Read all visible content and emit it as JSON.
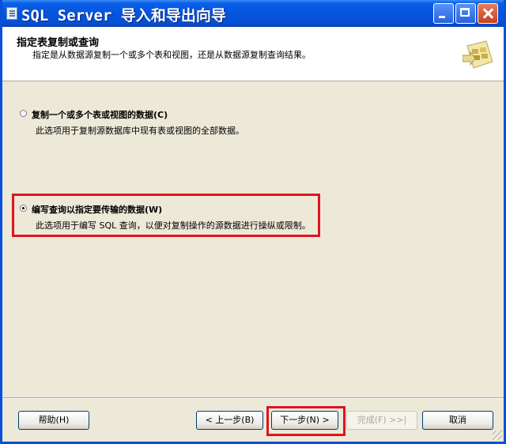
{
  "window": {
    "title": "SQL Server 导入和导出向导",
    "accent": "#0654dd"
  },
  "header": {
    "title": "指定表复制或查询",
    "description": "指定是从数据源复制一个或多个表和视图，还是从数据源复制查询结果。",
    "icon": "wizard-tables-icon"
  },
  "options": [
    {
      "label": "复制一个或多个表或视图的数据(C)",
      "description": "此选项用于复制源数据库中现有表或视图的全部数据。",
      "selected": false
    },
    {
      "label": "编写查询以指定要传输的数据(W)",
      "description": "此选项用于编写 SQL 查询，以便对复制操作的源数据进行操纵或限制。",
      "selected": true
    }
  ],
  "buttons": {
    "help": "帮助(H)",
    "back": "< 上一步(B)",
    "next": "下一步(N) >",
    "finish": "完成(F) >>|",
    "cancel": "取消"
  },
  "highlight_color": "#e0141e"
}
